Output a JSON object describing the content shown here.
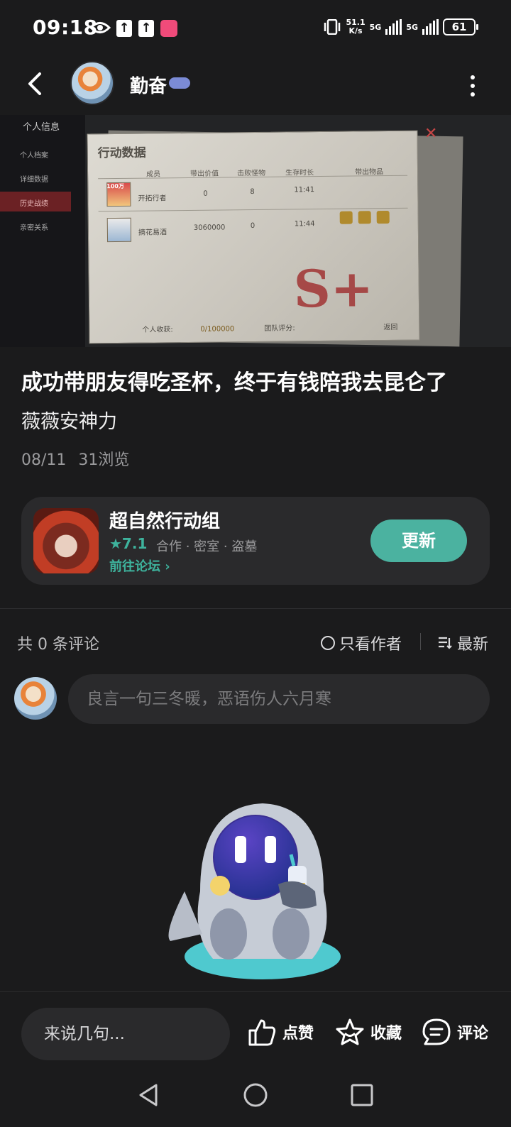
{
  "status_bar": {
    "time": "09:18",
    "net_speed_top": "51.1",
    "net_speed_bottom": "K/s",
    "net1": "5G",
    "net2": "5G",
    "battery": "61",
    "icons": [
      "eye-icon",
      "upload-icon",
      "upload-icon",
      "app-notification-icon",
      "vibrate-icon",
      "signal-icon",
      "signal-icon",
      "battery-icon"
    ]
  },
  "header": {
    "author": "勤奋",
    "icons": [
      "back-icon",
      "more-icon"
    ]
  },
  "hero": {
    "back_label": "个人信息",
    "side_items": [
      "个人档案",
      "详细数据",
      "历史战绩",
      "亲密关系"
    ],
    "panel_title": "行动数据",
    "columns": [
      "成员",
      "带出价值",
      "击败怪物",
      "生存时长",
      "带出物品"
    ],
    "rows": [
      {
        "name": "开拓行者",
        "value": "0",
        "kills": "8",
        "time": "11:41"
      },
      {
        "name": "摘花易酒",
        "value": "3060000",
        "kills": "0",
        "time": "11:44"
      }
    ],
    "badge": "100万",
    "grade": "S+",
    "income_label": "个人收获:",
    "income_value": "0/100000",
    "team_label": "团队评分:",
    "return_label": "返回"
  },
  "post": {
    "title": "成功带朋友得吃圣杯，终于有钱陪我去昆仑了",
    "subtitle": "薇薇安神力",
    "date": "08/11",
    "views": "31浏览"
  },
  "game_card": {
    "name": "超自然行动组",
    "rating": "★7.1",
    "tags": "合作 · 密室 · 盗墓",
    "forum_link": "前往论坛 ›",
    "update_label": "更新"
  },
  "comments": {
    "count": "共 0 条评论",
    "author_only": "只看作者",
    "sort": "最新",
    "input_placeholder": "良言一句三冬暖，恶语伤人六月寒"
  },
  "bottom_bar": {
    "say_placeholder": "来说几句...",
    "like": "点赞",
    "favorite": "收藏",
    "comment": "评论"
  },
  "colors": {
    "background": "#1b1b1c",
    "card": "#2a2a2c",
    "accent": "#4bb2a0"
  }
}
